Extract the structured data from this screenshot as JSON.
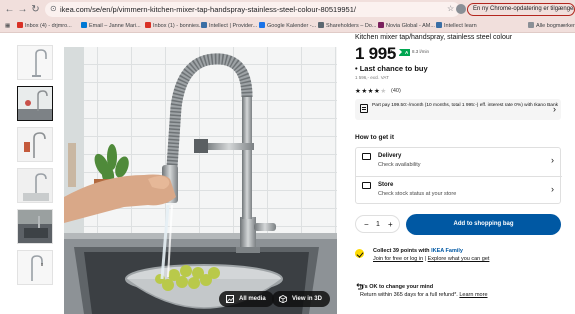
{
  "browser": {
    "url": "ikea.com/se/en/p/vimmern-kitchen-mixer-tap-handspray-stainless-steel-colour-80519951/",
    "update_chip": "En ny Chrome-opdatering er tilgængelig",
    "all_bookmarks": "Alle bogmærker",
    "bookmarks": [
      {
        "label": "Inbox (4) - drjmro..."
      },
      {
        "label": "Email – Janne Mari..."
      },
      {
        "label": "Inbox (1) - bonnies..."
      },
      {
        "label": "Intellect | Provider..."
      },
      {
        "label": "Google Kalender -..."
      },
      {
        "label": "Shareholders – Do..."
      },
      {
        "label": "Novia Global - AM..."
      },
      {
        "label": "Intellect learn"
      }
    ]
  },
  "gallery": {
    "all_media_label": "All media",
    "view_3d_label": "View in 3D"
  },
  "product": {
    "title": "Kitchen mixer tap/handspray, stainless steel colour",
    "price": "1 995",
    "price_suffix": ",-",
    "energy_class": "A",
    "energy_label": "8.3 l/min",
    "last_chance": "Last chance to buy",
    "excl_vat": "1 596,- excl. VAT",
    "rating_value": 4,
    "rating_count": "(40)",
    "finance_text": "Part pay 199.50:-/month (10 months, total 1 995:-) eff. interest rate 0%) with Ikano Bank"
  },
  "get_it": {
    "heading": "How to get it",
    "options": [
      {
        "title": "Delivery",
        "subtitle": "Check availability"
      },
      {
        "title": "Store",
        "subtitle": "Check stock status at your store"
      }
    ]
  },
  "cart": {
    "minus": "−",
    "quantity": "1",
    "plus": "+",
    "add_label": "Add to shopping bag"
  },
  "family": {
    "points_text": "Collect 39 points with ",
    "family_name": "IKEA Family",
    "join_link": "Join for free or log in",
    "separator": " | ",
    "explore_link": "Explore what you can get"
  },
  "returns": {
    "title": "It's OK to change your mind",
    "text": "Return within 365 days for a full refund*. ",
    "learn_more": "Learn more"
  },
  "colors": {
    "brand_blue": "#0058a3",
    "family_yellow": "#ffdb00",
    "energy_green": "#00a651"
  }
}
